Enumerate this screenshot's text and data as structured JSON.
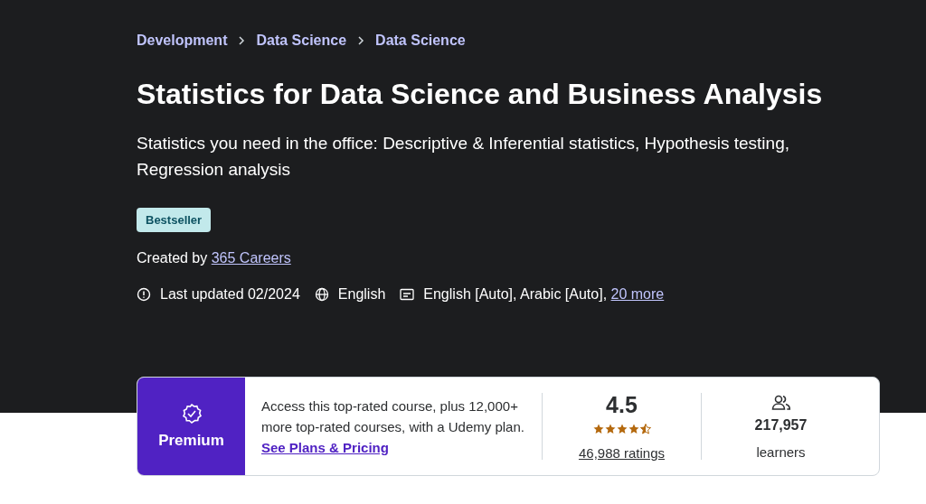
{
  "breadcrumbs": [
    "Development",
    "Data Science",
    "Data Science"
  ],
  "title": "Statistics for Data Science and Business Analysis",
  "subtitle": "Statistics you need in the office: Descriptive & Inferential statistics, Hypothesis testing, Regression analysis",
  "badge": "Bestseller",
  "created_by": {
    "label": "Created by",
    "author": "365 Careers"
  },
  "meta": {
    "last_updated": "Last updated 02/2024",
    "language": "English",
    "captions": "English [Auto], Arabic [Auto],",
    "captions_more": "20 more"
  },
  "premium": {
    "label": "Premium",
    "text": "Access this top-rated course, plus 12,000+ more top-rated courses, with a Udemy plan.",
    "link": "See Plans & Pricing"
  },
  "rating": {
    "value": "4.5",
    "stars": 4.5,
    "count": "46,988 ratings"
  },
  "learners": {
    "count": "217,957",
    "label": "learners"
  }
}
